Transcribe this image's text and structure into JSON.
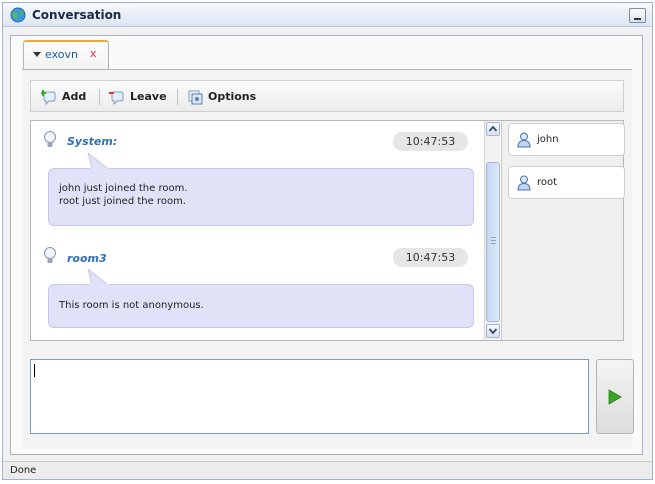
{
  "window": {
    "title": "Conversation",
    "title_icon": "globe-icon",
    "minimize_icon": "minimize-icon"
  },
  "tabs": [
    {
      "label": "exovn",
      "close_glyph": "x",
      "active": true
    }
  ],
  "toolbar": {
    "add_label": "Add",
    "leave_label": "Leave",
    "options_label": "Options"
  },
  "messages": [
    {
      "sender": "System:",
      "time": "10:47:53",
      "lines": [
        "john just joined the room.",
        "root just joined the room."
      ],
      "icon": "lightbulb-icon"
    },
    {
      "sender": "room3",
      "time": "10:47:53",
      "lines": [
        "This room is not anonymous."
      ],
      "icon": "lightbulb-icon"
    }
  ],
  "participants": [
    {
      "name": "john",
      "icon": "user-icon"
    },
    {
      "name": "root",
      "icon": "user-icon"
    }
  ],
  "composer": {
    "value": "",
    "send_icon": "send-arrow-icon"
  },
  "status": {
    "text": "Done"
  },
  "colors": {
    "bubble": "#e1e2f8",
    "sender": "#2f6fb8",
    "tab_accent": "#e8ac3a",
    "send_arrow": "#3aa628"
  }
}
